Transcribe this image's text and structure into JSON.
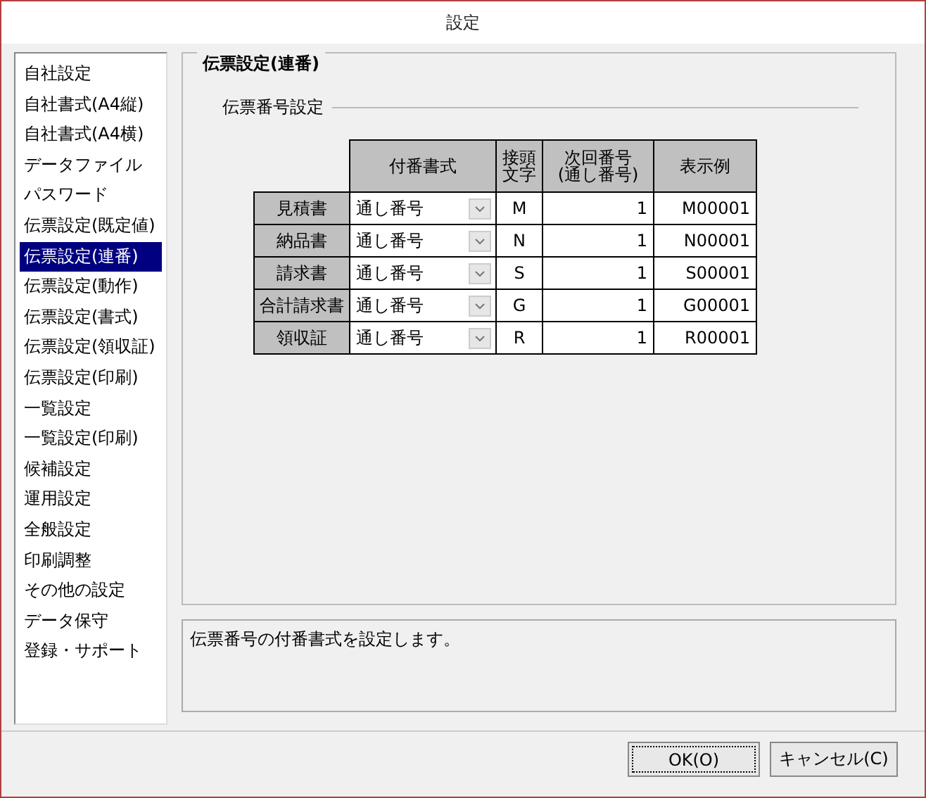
{
  "window": {
    "title": "設定"
  },
  "sidebar": {
    "items": [
      {
        "label": "自社設定",
        "selected": false
      },
      {
        "label": "自社書式(A4縦)",
        "selected": false
      },
      {
        "label": "自社書式(A4横)",
        "selected": false
      },
      {
        "label": "データファイル",
        "selected": false
      },
      {
        "label": "パスワード",
        "selected": false
      },
      {
        "label": "伝票設定(既定値)",
        "selected": false
      },
      {
        "label": "伝票設定(連番)",
        "selected": true
      },
      {
        "label": "伝票設定(動作)",
        "selected": false
      },
      {
        "label": "伝票設定(書式)",
        "selected": false
      },
      {
        "label": "伝票設定(領収証)",
        "selected": false
      },
      {
        "label": "伝票設定(印刷)",
        "selected": false
      },
      {
        "label": "一覧設定",
        "selected": false
      },
      {
        "label": "一覧設定(印刷)",
        "selected": false
      },
      {
        "label": "候補設定",
        "selected": false
      },
      {
        "label": "運用設定",
        "selected": false
      },
      {
        "label": "全般設定",
        "selected": false
      },
      {
        "label": "印刷調整",
        "selected": false
      },
      {
        "label": "その他の設定",
        "selected": false
      },
      {
        "label": "データ保守",
        "selected": false
      },
      {
        "label": "登録・サポート",
        "selected": false
      }
    ]
  },
  "panel": {
    "title": "伝票設定(連番)",
    "section": "伝票番号設定",
    "table": {
      "columns": [
        {
          "lines": [
            "付番書式"
          ]
        },
        {
          "lines": [
            "接頭",
            "文字"
          ]
        },
        {
          "lines": [
            "次回番号",
            "(通し番号)"
          ]
        },
        {
          "lines": [
            "表示例"
          ]
        }
      ],
      "rows": [
        {
          "name": "見積書",
          "format": "通し番号",
          "prefix": "M",
          "next": "1",
          "example": "M00001"
        },
        {
          "name": "納品書",
          "format": "通し番号",
          "prefix": "N",
          "next": "1",
          "example": "N00001"
        },
        {
          "name": "請求書",
          "format": "通し番号",
          "prefix": "S",
          "next": "1",
          "example": "S00001"
        },
        {
          "name": "合計請求書",
          "format": "通し番号",
          "prefix": "G",
          "next": "1",
          "example": "G00001"
        },
        {
          "name": "領収証",
          "format": "通し番号",
          "prefix": "R",
          "next": "1",
          "example": "R00001"
        }
      ]
    }
  },
  "description": "伝票番号の付番書式を設定します。",
  "buttons": [
    "OK(O)",
    "キャンセル(C)"
  ]
}
